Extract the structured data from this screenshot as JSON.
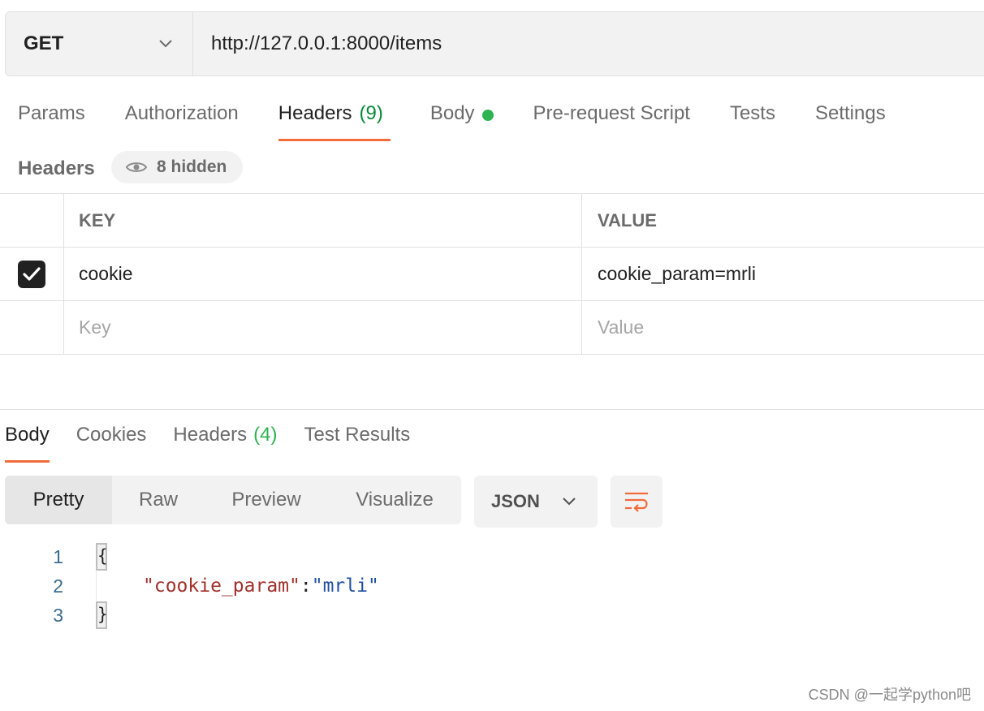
{
  "request": {
    "method": "GET",
    "url": "http://127.0.0.1:8000/items"
  },
  "request_tabs": [
    {
      "label": "Params"
    },
    {
      "label": "Authorization"
    },
    {
      "label": "Headers",
      "count": "(9)",
      "active": true
    },
    {
      "label": "Body",
      "indicator": "green-dot"
    },
    {
      "label": "Pre-request Script"
    },
    {
      "label": "Tests"
    },
    {
      "label": "Settings"
    }
  ],
  "headers_section": {
    "title": "Headers",
    "hidden_label": "8 hidden",
    "table": {
      "key_header": "KEY",
      "value_header": "VALUE",
      "rows": [
        {
          "checked": true,
          "key": "cookie",
          "value": "cookie_param=mrli"
        }
      ],
      "new_row": {
        "key_placeholder": "Key",
        "value_placeholder": "Value"
      }
    }
  },
  "response_tabs": [
    {
      "label": "Body",
      "active": true
    },
    {
      "label": "Cookies"
    },
    {
      "label": "Headers",
      "count": "(4)"
    },
    {
      "label": "Test Results"
    }
  ],
  "view_modes": [
    {
      "label": "Pretty",
      "active": true
    },
    {
      "label": "Raw"
    },
    {
      "label": "Preview"
    },
    {
      "label": "Visualize"
    }
  ],
  "format": "JSON",
  "code": {
    "lines": [
      "1",
      "2",
      "3"
    ],
    "open_brace": "{",
    "key": "\"cookie_param\"",
    "colon": ": ",
    "value": "\"mrli\"",
    "close_brace": "}"
  },
  "watermark": "CSDN @一起学python吧",
  "colors": {
    "accent": "#f26b3a",
    "green": "#2eb351",
    "json_key": "#a1302a",
    "json_value": "#1f4fa0"
  }
}
